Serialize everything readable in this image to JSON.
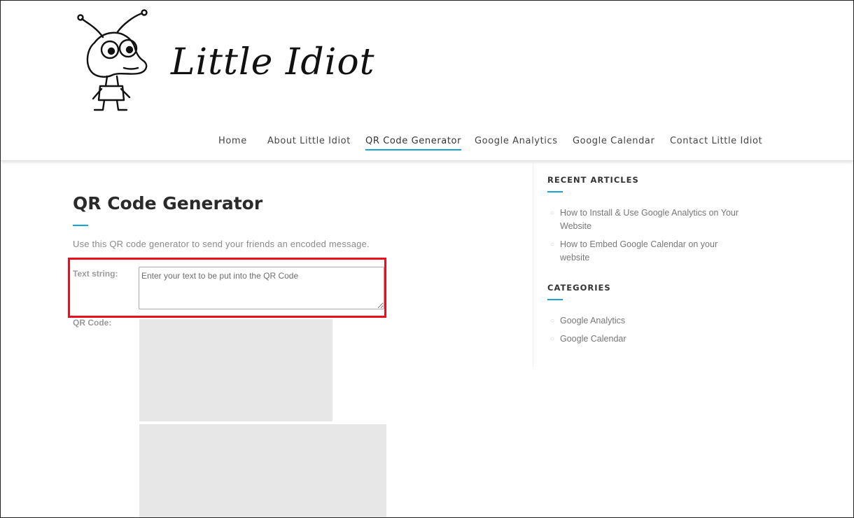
{
  "site": {
    "logo_text": "Little Idiot"
  },
  "nav": {
    "items": [
      {
        "label": "Home"
      },
      {
        "label": "About Little Idiot"
      },
      {
        "label": "QR Code Generator"
      },
      {
        "label": "Google Analytics"
      },
      {
        "label": "Google Calendar"
      },
      {
        "label": "Contact Little Idiot"
      }
    ],
    "active_index": 2
  },
  "main": {
    "title": "QR Code Generator",
    "intro": "Use this QR code generator to send your friends an encoded message.",
    "text_string_label": "Text string:",
    "text_placeholder": "Enter your text to be put into the QR Code",
    "text_value": "",
    "qr_label": "QR Code:"
  },
  "sidebar": {
    "recent": {
      "title": "RECENT ARTICLES",
      "items": [
        {
          "label": "How to Install & Use Google Analytics on Your Website"
        },
        {
          "label": "How to Embed Google Calendar on your website"
        }
      ]
    },
    "categories": {
      "title": "CATEGORIES",
      "items": [
        {
          "label": "Google Analytics"
        },
        {
          "label": "Google Calendar"
        }
      ]
    }
  },
  "colors": {
    "accent": "#1aa3d6",
    "highlight": "#e8101d",
    "placeholder_box": "#e7e7e7"
  },
  "icons": {
    "logo": "ant-mascot-icon",
    "bullet": "circle-bullet-icon"
  }
}
